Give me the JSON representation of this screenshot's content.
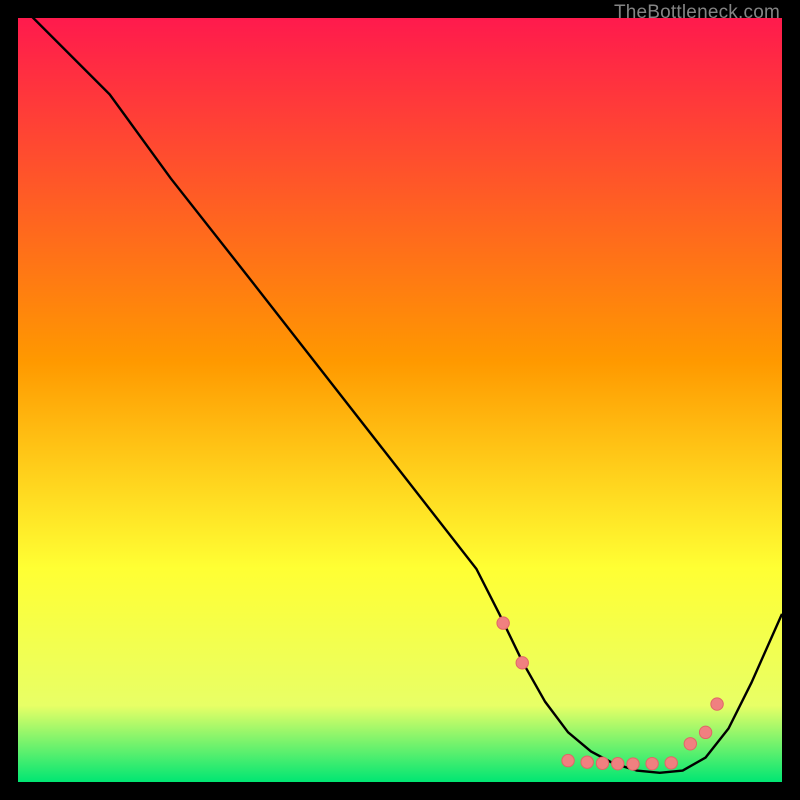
{
  "watermark": "TheBottleneck.com",
  "colors": {
    "frame": "#000000",
    "curve": "#000000",
    "dot_fill": "#f08080",
    "dot_stroke": "#e06666",
    "grad_top": "#ff1a4d",
    "grad_mid1": "#ff9900",
    "grad_mid2": "#ffff33",
    "grad_mid3": "#e8ff66",
    "grad_bottom": "#00e673"
  },
  "chart_data": {
    "type": "line",
    "title": "",
    "xlabel": "",
    "ylabel": "",
    "xlim": [
      0,
      100
    ],
    "ylim": [
      0,
      100
    ],
    "curve": {
      "x": [
        0,
        12,
        20,
        30,
        40,
        50,
        60,
        63,
        66,
        69,
        72,
        75,
        78,
        81,
        84,
        87,
        90,
        93,
        96,
        100
      ],
      "y": [
        102,
        90,
        79,
        66.3,
        53.5,
        40.7,
        27.9,
        22,
        15.8,
        10.5,
        6.5,
        4,
        2.4,
        1.5,
        1.2,
        1.5,
        3.2,
        7,
        13,
        22
      ]
    },
    "markers": {
      "x": [
        63.5,
        66,
        72,
        74.5,
        76.5,
        78.5,
        80.5,
        83,
        85.5,
        88,
        90,
        91.5
      ],
      "y": [
        20.8,
        15.6,
        2.8,
        2.6,
        2.45,
        2.4,
        2.35,
        2.4,
        2.5,
        5,
        6.5,
        10.2
      ]
    }
  }
}
